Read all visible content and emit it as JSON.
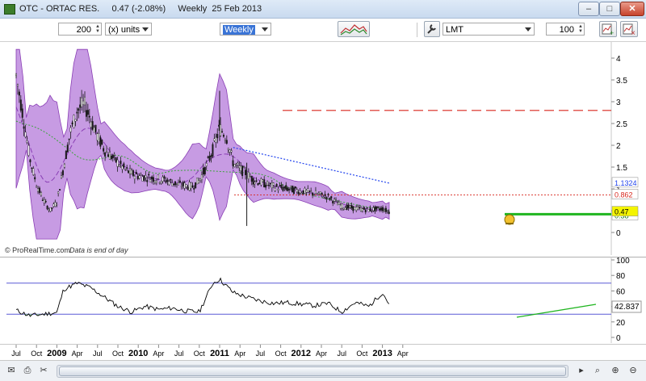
{
  "window": {
    "title": "OTC - ORTAC RES.     0.47 (-2.08%)     Weekly  25 Feb 2013",
    "minimize": "–",
    "maximize": "□",
    "close": "✕"
  },
  "toolbar": {
    "units_value": "200",
    "units_select": "(x) units",
    "period_select": "Weekly",
    "indicator_select": "LMT",
    "bars_value": "100"
  },
  "price_axis": {
    "ticks": [
      "4",
      "3.5",
      "3",
      "2.5",
      "2",
      "1.5",
      "1",
      "0.5",
      "0"
    ],
    "label_blue": "1.1324",
    "label_red": "0.862",
    "label_last": "0.47",
    "label_green": "0.38"
  },
  "chart_footer": {
    "source": "© ProRealTime.com",
    "note": "Data is end of day"
  },
  "osc_axis": {
    "ticks": [
      "100",
      "80",
      "60",
      "40",
      "20",
      "0"
    ],
    "value_label": "42.837"
  },
  "x_axis": {
    "ticks": [
      "Jul",
      "Oct",
      "2009",
      "Apr",
      "Jul",
      "Oct",
      "2010",
      "Apr",
      "Jul",
      "Oct",
      "2011",
      "Apr",
      "Jul",
      "Oct",
      "2012",
      "Apr",
      "Jul",
      "Oct",
      "2013",
      "Apr"
    ]
  },
  "colors": {
    "band_fill": "#c79be3",
    "band_edge": "#8a3fb5",
    "candles": "#1a1a1a",
    "ma_green": "#39a33a",
    "ma_blue": "#2244ee",
    "resistance_red": "#d8261c",
    "support_green": "#1fb51f",
    "osc_line": "#000000",
    "osc_bounds": "#5a5ad6"
  },
  "chart_data": [
    {
      "type": "line",
      "title": "",
      "series": [
        {
          "name": "",
          "x": [
            "2008-07",
            "2008-08",
            "2008-09",
            "2008-10",
            "2008-11",
            "2008-12",
            "2009-01",
            "2009-02",
            "2009-03",
            "2009-04",
            "2009-05",
            "2009-06",
            "2009-07",
            "2009-08",
            "2009-09",
            "2009-10",
            "2009-11",
            "2009-12",
            "2010-01",
            "2010-03",
            "2010-05",
            "2010-07",
            "2010-09",
            "2010-10",
            "2010-11",
            "2010-12",
            "2011-01",
            "2011-02",
            "2011-03",
            "2011-04",
            "2011-05",
            "2011-06",
            "2011-07",
            "2011-09",
            "2011-11",
            "2012-01",
            "2012-03",
            "2012-05",
            "2012-07",
            "2012-09",
            "2012-11",
            "2013-01",
            "2013-02"
          ],
          "values": [
            3.6,
            2.7,
            1.7,
            1.1,
            0.75,
            0.5,
            0.7,
            1.5,
            2.3,
            2.8,
            2.95,
            2.6,
            2.2,
            1.9,
            1.75,
            1.6,
            1.45,
            1.35,
            1.3,
            1.25,
            1.2,
            1.1,
            1.05,
            1.2,
            1.5,
            1.9,
            2.4,
            2.2,
            1.6,
            1.45,
            1.35,
            1.2,
            1.15,
            1.05,
            1.0,
            0.95,
            0.9,
            0.82,
            0.6,
            0.55,
            0.52,
            0.55,
            0.47
          ]
        }
      ],
      "last_value": 0.47,
      "last_change": "-2.08%",
      "resistance_level": 2.8,
      "minor_resistance": 0.862,
      "support_level": 0.42,
      "upper_ma_label": 1.1324,
      "ylim": [
        0,
        4
      ],
      "xlabel": "",
      "ylabel": ""
    },
    {
      "type": "line",
      "title": "",
      "series": [
        {
          "name": "",
          "x": [
            "2008-07",
            "2008-09",
            "2008-11",
            "2009-01",
            "2009-02",
            "2009-04",
            "2009-06",
            "2009-08",
            "2009-10",
            "2009-12",
            "2010-02",
            "2010-04",
            "2010-06",
            "2010-08",
            "2010-10",
            "2010-12",
            "2011-01",
            "2011-03",
            "2011-05",
            "2011-07",
            "2011-09",
            "2011-11",
            "2012-01",
            "2012-03",
            "2012-05",
            "2012-07",
            "2012-09",
            "2012-11",
            "2013-01",
            "2013-02"
          ],
          "values": [
            35,
            28,
            30,
            32,
            62,
            70,
            64,
            52,
            40,
            33,
            40,
            36,
            38,
            34,
            33,
            70,
            75,
            58,
            52,
            47,
            44,
            45,
            43,
            41,
            44,
            33,
            45,
            40,
            58,
            43
          ]
        }
      ],
      "upper_bound": 70,
      "lower_bound": 30,
      "last_value": 42.837,
      "ylim": [
        0,
        100
      ],
      "xlabel": "",
      "ylabel": ""
    }
  ]
}
